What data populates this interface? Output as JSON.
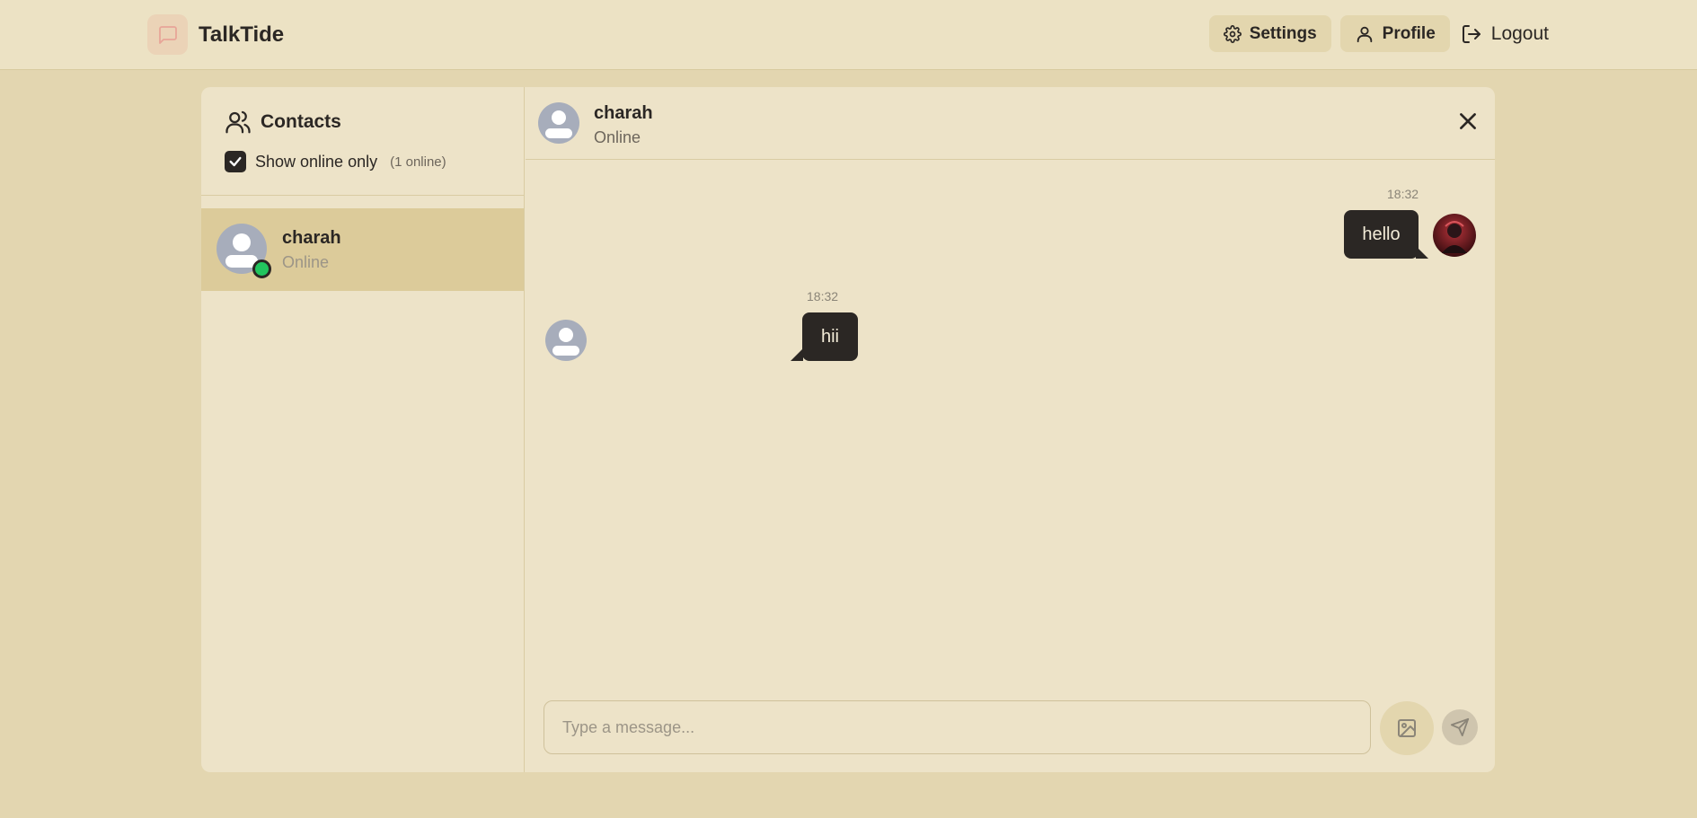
{
  "app": {
    "name": "TalkTide",
    "logo_icon": "message-square-icon",
    "brand_color": "#e8a598"
  },
  "nav": {
    "settings_label": "Settings",
    "profile_label": "Profile",
    "logout_label": "Logout"
  },
  "sidebar": {
    "title": "Contacts",
    "filter_label": "Show online only",
    "filter_checked": true,
    "online_count": "(1 online)",
    "contacts": [
      {
        "name": "charah",
        "status": "Online",
        "online": true,
        "status_color": "#22c55e"
      }
    ]
  },
  "chat": {
    "name": "charah",
    "status": "Online",
    "messages": [
      {
        "from": "me",
        "time": "18:32",
        "text": "hello"
      },
      {
        "from": "charah",
        "time": "18:32",
        "text": "hii"
      }
    ],
    "input_placeholder": "Type a message..."
  }
}
